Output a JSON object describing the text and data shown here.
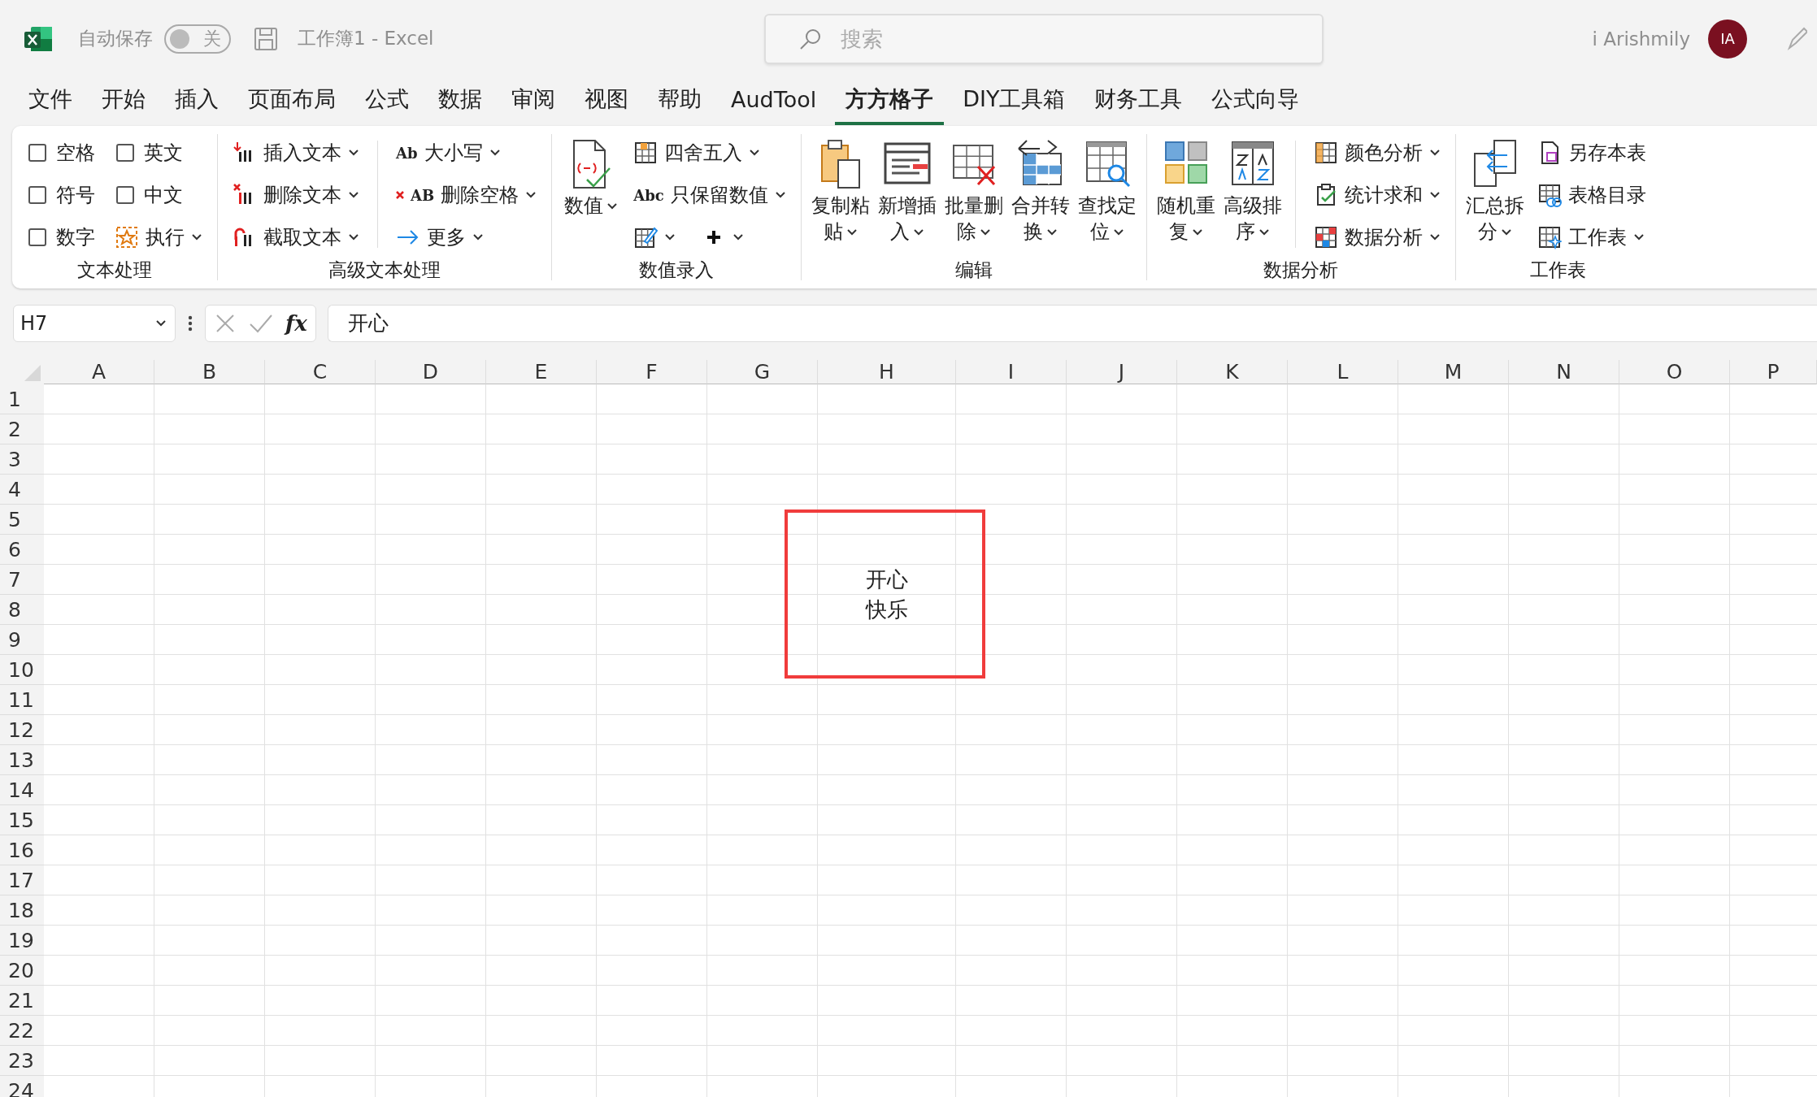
{
  "title_bar": {
    "autosave_label": "自动保存",
    "autosave_toggle": {
      "label": "关",
      "on": false
    },
    "document_title": "工作簿1  -  Excel",
    "search": {
      "placeholder": "搜索"
    },
    "user_name": "i Arishmily",
    "avatar": "IA"
  },
  "menu_tabs": [
    {
      "label": "文件",
      "selected": false
    },
    {
      "label": "开始",
      "selected": false
    },
    {
      "label": "插入",
      "selected": false
    },
    {
      "label": "页面布局",
      "selected": false
    },
    {
      "label": "公式",
      "selected": false
    },
    {
      "label": "数据",
      "selected": false
    },
    {
      "label": "审阅",
      "selected": false
    },
    {
      "label": "视图",
      "selected": false
    },
    {
      "label": "帮助",
      "selected": false
    },
    {
      "label": "AudTool",
      "selected": false
    },
    {
      "label": "方方格子",
      "selected": true
    },
    {
      "label": "DIY工具箱",
      "selected": false
    },
    {
      "label": "财务工具",
      "selected": false
    },
    {
      "label": "公式向导",
      "selected": false
    }
  ],
  "ribbon": {
    "groups": [
      {
        "label": "文本处理",
        "parts": [
          {
            "kind": "stack",
            "items": [
              {
                "kind": "checkbox",
                "label": "空格",
                "checked": false
              },
              {
                "kind": "checkbox",
                "label": "符号",
                "checked": false
              },
              {
                "kind": "checkbox",
                "label": "数字",
                "checked": false
              }
            ]
          },
          {
            "kind": "stack",
            "items": [
              {
                "kind": "checkbox",
                "label": "英文",
                "checked": false
              },
              {
                "kind": "checkbox",
                "label": "中文",
                "checked": false
              },
              {
                "kind": "button",
                "label": "执行",
                "dropdown": true
              }
            ]
          }
        ]
      },
      {
        "label": "高级文本处理",
        "parts": [
          {
            "kind": "stack",
            "items": [
              {
                "kind": "button",
                "label": "插入文本",
                "dropdown": true
              },
              {
                "kind": "button",
                "label": "删除文本",
                "dropdown": true
              },
              {
                "kind": "button",
                "label": "截取文本",
                "dropdown": true
              }
            ]
          },
          {
            "kind": "separator"
          },
          {
            "kind": "stack",
            "items": [
              {
                "kind": "button",
                "glyph": "Ab",
                "label": "大小写",
                "dropdown": true
              },
              {
                "kind": "button",
                "glyph": "AB",
                "label": "删除空格",
                "dropdown": true
              },
              {
                "kind": "button",
                "label": "更多",
                "dropdown": true
              }
            ]
          }
        ]
      },
      {
        "label": "数值录入",
        "parts": [
          {
            "kind": "large",
            "label": "数值",
            "dropdown": true
          },
          {
            "kind": "stack",
            "items": [
              {
                "kind": "button",
                "label": "四舍五入",
                "dropdown": true
              },
              {
                "kind": "button",
                "glyph": "Abc",
                "label": "只保留数值",
                "dropdown": true
              },
              {
                "kind": "icon_row",
                "buttons": [
                  {
                    "dropdown": true
                  },
                  {
                    "dropdown": true
                  }
                ]
              }
            ]
          }
        ]
      },
      {
        "label": "编辑",
        "parts": [
          {
            "kind": "large",
            "label": "复制粘贴",
            "dropdown": true
          },
          {
            "kind": "large",
            "label": "新增插入",
            "dropdown": true
          },
          {
            "kind": "large",
            "label": "批量删除",
            "dropdown": true
          },
          {
            "kind": "large",
            "label": "合并转换",
            "dropdown": true
          },
          {
            "kind": "large",
            "label": "查找定位",
            "dropdown": true
          }
        ]
      },
      {
        "label": "数据分析",
        "parts": [
          {
            "kind": "large",
            "label": "随机重复",
            "dropdown": true
          },
          {
            "kind": "large",
            "label": "高级排序",
            "dropdown": true
          },
          {
            "kind": "separator"
          },
          {
            "kind": "stack",
            "items": [
              {
                "kind": "button",
                "label": "颜色分析",
                "dropdown": true
              },
              {
                "kind": "button",
                "label": "统计求和",
                "dropdown": true
              },
              {
                "kind": "button",
                "label": "数据分析",
                "dropdown": true
              }
            ]
          }
        ]
      },
      {
        "label": "工作表",
        "parts": [
          {
            "kind": "large",
            "label": "汇总拆分",
            "dropdown": true
          },
          {
            "kind": "stack",
            "items": [
              {
                "kind": "button",
                "label": "另存本表",
                "dropdown": false
              },
              {
                "kind": "button",
                "label": "表格目录",
                "dropdown": false
              },
              {
                "kind": "button",
                "label": "工作表",
                "dropdown": true
              }
            ]
          }
        ]
      }
    ]
  },
  "formula_bar": {
    "name_box": "H7",
    "fx": "fx",
    "value": "开心"
  },
  "sheet": {
    "columns": [
      "A",
      "B",
      "C",
      "D",
      "E",
      "F",
      "G",
      "H",
      "I",
      "J",
      "K",
      "L",
      "M",
      "N",
      "O",
      "P"
    ],
    "rows": [
      "1",
      "2",
      "3",
      "4",
      "5",
      "6",
      "7",
      "8",
      "9",
      "10",
      "11",
      "12",
      "13",
      "14",
      "15",
      "16",
      "17",
      "18",
      "19",
      "20",
      "21",
      "22",
      "23",
      "24"
    ],
    "active_cell": {
      "lines": [
        "开心",
        "快乐"
      ]
    }
  },
  "annotation": {
    "kind": "rectangle",
    "color": "#f03c3c"
  }
}
